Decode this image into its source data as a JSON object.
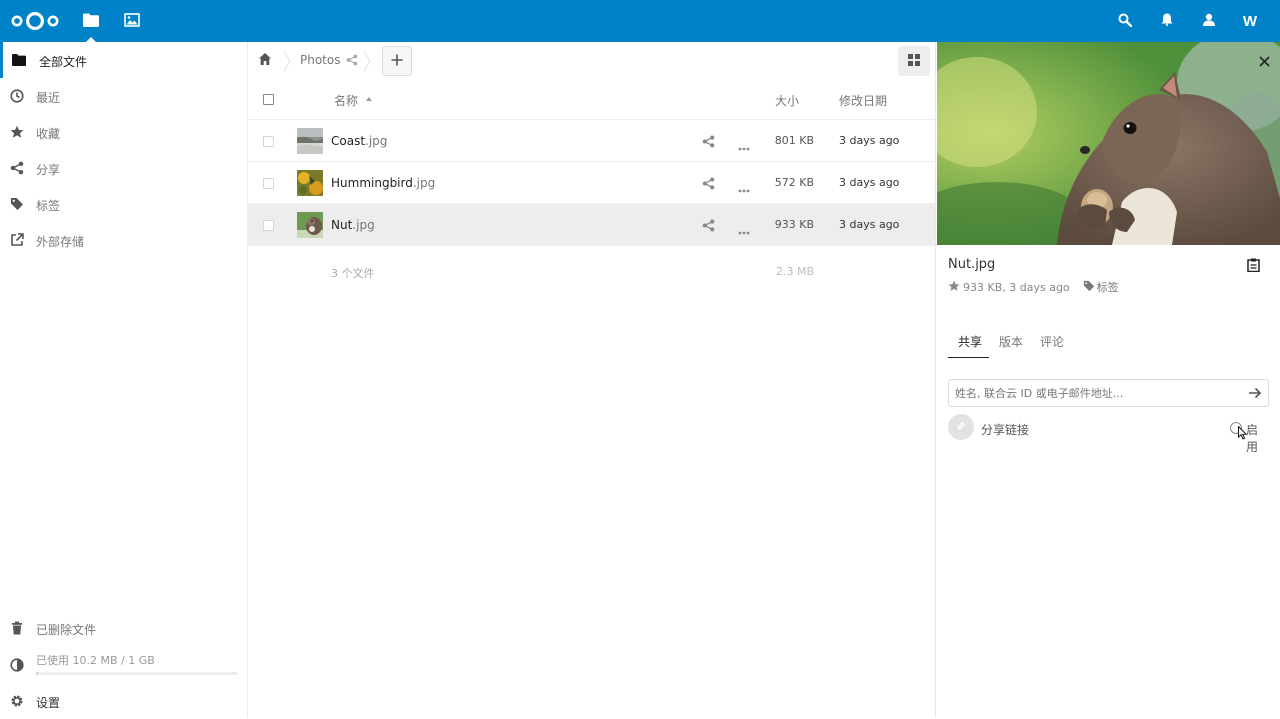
{
  "header": {
    "apps": [
      {
        "name": "files-app",
        "active": true
      },
      {
        "name": "gallery-app",
        "active": false
      }
    ],
    "avatar_letter": "W"
  },
  "sidebar": {
    "items": [
      {
        "label": "全部文件",
        "icon": "folder-icon",
        "active": true
      },
      {
        "label": "最近",
        "icon": "clock-icon"
      },
      {
        "label": "收藏",
        "icon": "star-icon"
      },
      {
        "label": "分享",
        "icon": "share-icon"
      },
      {
        "label": "标签",
        "icon": "tag-icon"
      },
      {
        "label": "外部存储",
        "icon": "external-icon"
      }
    ],
    "trash_label": "已删除文件",
    "quota_label": "已使用 10.2 MB / 1 GB",
    "quota_fraction": 0.0102,
    "settings_label": "设置"
  },
  "breadcrumb": {
    "folder": "Photos"
  },
  "table": {
    "headers": {
      "name": "名称",
      "size": "大小",
      "modified": "修改日期"
    },
    "rows": [
      {
        "base": "Coast",
        "ext": ".jpg",
        "size": "801 KB",
        "modified": "3 days ago",
        "selected": false
      },
      {
        "base": "Hummingbird",
        "ext": ".jpg",
        "size": "572 KB",
        "modified": "3 days ago",
        "selected": false
      },
      {
        "base": "Nut",
        "ext": ".jpg",
        "size": "933 KB",
        "modified": "3 days ago",
        "selected": true
      }
    ],
    "summary": {
      "count": "3 个文件",
      "size": "2.3 MB"
    }
  },
  "details": {
    "title": "Nut.jpg",
    "meta": "933 KB, 3 days ago",
    "tags_label": "标签",
    "tabs": [
      "共享",
      "版本",
      "评论"
    ],
    "share_placeholder": "姓名, 联合云 ID 或电子邮件地址...",
    "link_label": "分享链接",
    "enable_label": "启用"
  },
  "colors": {
    "brand": "#0082c9"
  }
}
